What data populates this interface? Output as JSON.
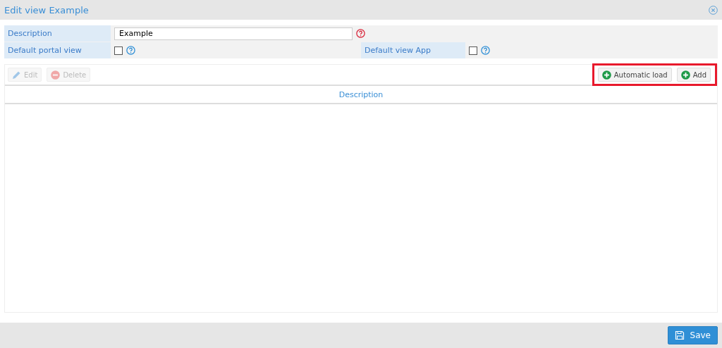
{
  "window": {
    "title": "Edit view Example"
  },
  "form": {
    "description": {
      "label": "Description",
      "value": "Example",
      "required": true
    },
    "checks": [
      {
        "label": "Default portal view",
        "checked": false
      },
      {
        "label": "Default view App",
        "checked": false
      }
    ]
  },
  "toolbar": {
    "left": [
      {
        "label": "Edit",
        "kind": "edit",
        "disabled": true
      },
      {
        "label": "Delete",
        "kind": "delete",
        "disabled": true
      }
    ],
    "right": [
      {
        "label": "Automatic load",
        "kind": "add",
        "disabled": false
      },
      {
        "label": "Add",
        "kind": "add",
        "disabled": false
      }
    ],
    "highlighted": true
  },
  "table": {
    "columns": [
      "Description"
    ]
  },
  "footer": {
    "save": "Save"
  }
}
